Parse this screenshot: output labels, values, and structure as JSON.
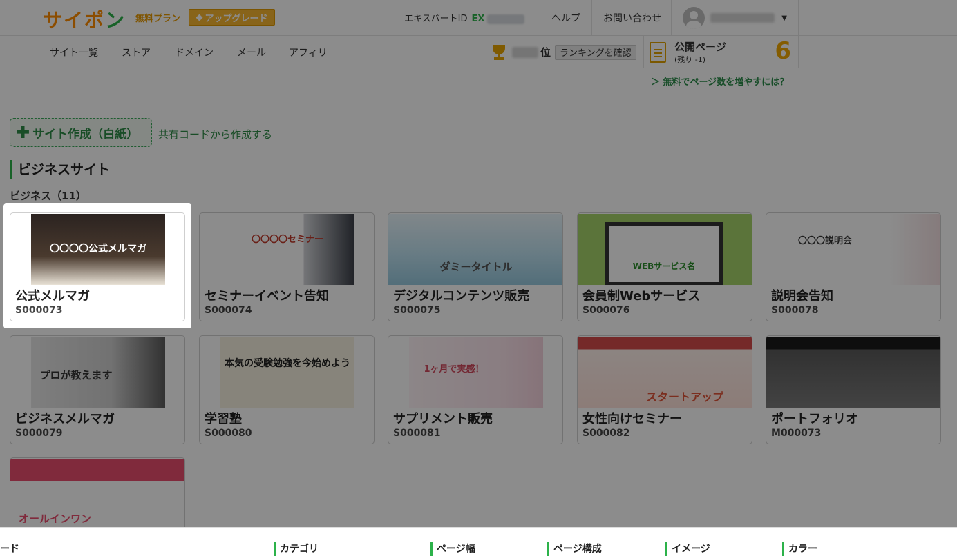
{
  "header": {
    "logo_main": "サイポ",
    "logo_accent": "ン",
    "plan": "無料プラン",
    "upgrade_label": "アップグレード",
    "expert_label": "エキスパートID",
    "expert_prefix": "EX",
    "help": "ヘルプ",
    "contact": "お問い合わせ"
  },
  "nav": {
    "items": [
      "サイト一覧",
      "ストア",
      "ドメイン",
      "メール",
      "アフィリ"
    ],
    "rank_suffix": "位",
    "rank_button": "ランキングを確認",
    "pub_title": "公開ページ",
    "pub_sub": "(残り -1)",
    "pub_count": "6",
    "more_pages": "＞ 無料でページ数を増やすには？"
  },
  "main": {
    "create_label": "サイト作成（白紙）",
    "share_code": "共有コードから作成する",
    "section_title": "ビジネスサイト",
    "sub_title": "ビジネス（11）"
  },
  "cards": [
    {
      "name": "公式メルマガ",
      "code": "S000073",
      "thumb_text": "〇〇〇〇公式メルマガ"
    },
    {
      "name": "セミナーイベント告知",
      "code": "S000074",
      "thumb_text": "〇〇〇〇セミナー"
    },
    {
      "name": "デジタルコンテンツ販売",
      "code": "S000075",
      "thumb_text": "ダミータイトル"
    },
    {
      "name": "会員制Webサービス",
      "code": "S000076",
      "thumb_text": "WEBサービス名"
    },
    {
      "name": "説明会告知",
      "code": "S000078",
      "thumb_text": "〇〇〇説明会"
    },
    {
      "name": "ビジネスメルマガ",
      "code": "S000079",
      "thumb_text": "プロが教えます"
    },
    {
      "name": "学習塾",
      "code": "S000080",
      "thumb_text": "本気の受験勉強を今始めよう"
    },
    {
      "name": "サプリメント販売",
      "code": "S000081",
      "thumb_text": "1ヶ月で実感！"
    },
    {
      "name": "女性向けセミナー",
      "code": "S000082",
      "thumb_text": "スタートアップ"
    },
    {
      "name": "ポートフォリオ",
      "code": "M000073",
      "thumb_text": ""
    },
    {
      "name": "",
      "code": "",
      "thumb_text": "オールインワン"
    }
  ],
  "filters": {
    "items": [
      "ード",
      "カテゴリ",
      "ページ幅",
      "ページ構成",
      "イメージ",
      "カラー"
    ]
  },
  "colors": {
    "brand_green": "#2cb24a",
    "brand_orange": "#ff8c00",
    "upgrade_bg": "#f7b731"
  }
}
